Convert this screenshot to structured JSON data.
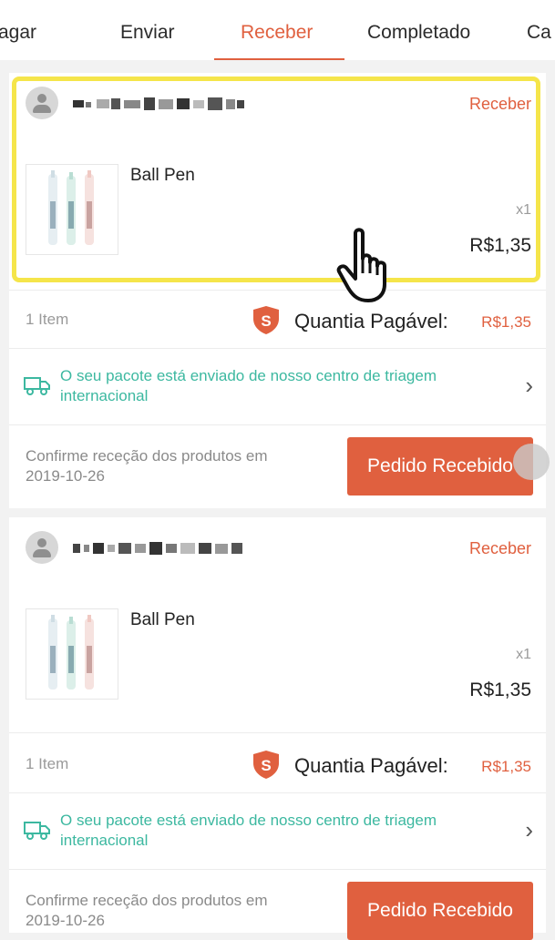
{
  "tabs": [
    {
      "label": "agar",
      "active": false
    },
    {
      "label": "Enviar",
      "active": false
    },
    {
      "label": "Receber",
      "active": true
    },
    {
      "label": "Completado",
      "active": false
    },
    {
      "label": "Ca",
      "active": false
    }
  ],
  "orders": [
    {
      "status": "Receber",
      "product_name": "Ball Pen",
      "quantity": "x1",
      "price": "R$1,35",
      "item_count": "1 Item",
      "payable_label": "Quantia Pagável:",
      "payable_value": "R$1,35",
      "tracking_line1": "O seu pacote está enviado de nosso centro de triagem",
      "tracking_line2": "internacional",
      "confirm_line1": "Confirme receção dos produtos em",
      "confirm_line2": "2019-10-26",
      "button_label": "Pedido Recebido"
    },
    {
      "status": "Receber",
      "product_name": "Ball Pen",
      "quantity": "x1",
      "price": "R$1,35",
      "item_count": "1 Item",
      "payable_label": "Quantia Pagável:",
      "payable_value": "R$1,35",
      "tracking_line1": "O seu pacote está enviado de nosso centro de triagem",
      "tracking_line2": "internacional",
      "confirm_line1": "Confirme receção dos produtos em",
      "confirm_line2": "2019-10-26",
      "button_label": "Pedido Recebido"
    }
  ],
  "icons": {
    "avatar": "user-avatar-icon",
    "shield": "shopee-guarantee-shield-icon",
    "truck": "delivery-truck-icon",
    "chevron": "chevron-right-icon",
    "cursor": "hand-pointer-cursor-icon"
  },
  "colors": {
    "accent": "#e0603f",
    "tracking": "#3cb8a0",
    "highlight": "#f5e54a"
  }
}
